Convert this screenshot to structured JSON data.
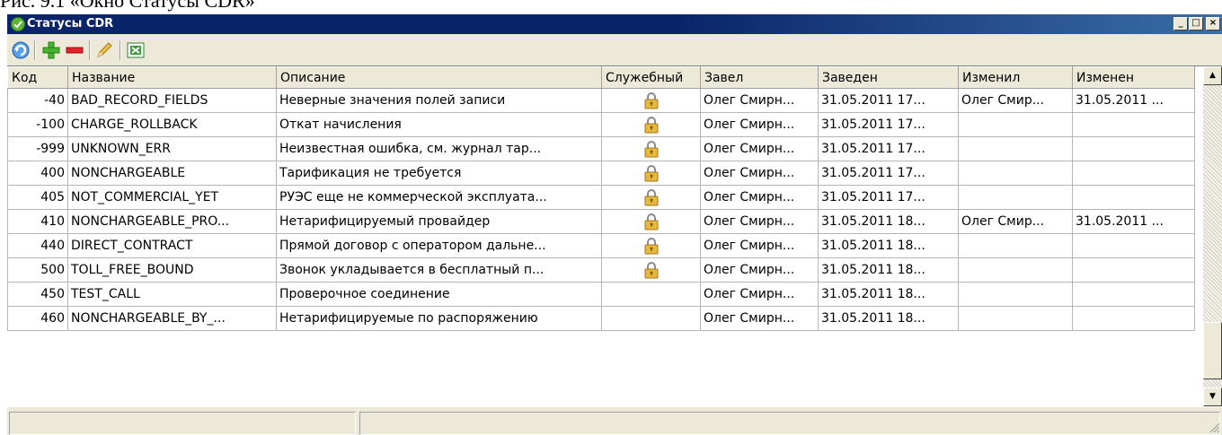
{
  "caption": "Рис. 9.1 «Окно Статусы CDR»",
  "window": {
    "title": "Статусы CDR",
    "app_icon": "green-check-shield-icon",
    "controls": {
      "minimize": "_",
      "maximize": "□",
      "close": "×"
    }
  },
  "toolbar": {
    "buttons": [
      {
        "name": "refresh",
        "icon": "refresh-icon"
      },
      {
        "name": "add",
        "icon": "plus-icon"
      },
      {
        "name": "delete",
        "icon": "minus-icon"
      },
      {
        "name": "edit",
        "icon": "pencil-icon"
      },
      {
        "name": "export",
        "icon": "excel-icon"
      }
    ]
  },
  "grid": {
    "columns": [
      "Код",
      "Название",
      "Описание",
      "Служебный",
      "Завел",
      "Заведен",
      "Изменил",
      "Изменен"
    ],
    "rows": [
      {
        "code": "-40",
        "name": "BAD_RECORD_FIELDS",
        "desc": "Неверные значения полей записи",
        "service": true,
        "created_by": "Олег Смирн...",
        "created_at": "31.05.2011 17...",
        "modified_by": "Олег Смир...",
        "modified_at": "31.05.2011 ..."
      },
      {
        "code": "-100",
        "name": "CHARGE_ROLLBACK",
        "desc": "Откат начисления",
        "service": true,
        "created_by": "Олег Смирн...",
        "created_at": "31.05.2011 17...",
        "modified_by": "",
        "modified_at": ""
      },
      {
        "code": "-999",
        "name": "UNKNOWN_ERR",
        "desc": "Неизвестная ошибка, см. журнал тар...",
        "service": true,
        "created_by": "Олег Смирн...",
        "created_at": "31.05.2011 17...",
        "modified_by": "",
        "modified_at": ""
      },
      {
        "code": "400",
        "name": "NONCHARGEABLE",
        "desc": "Тарификация не требуется",
        "service": true,
        "created_by": "Олег Смирн...",
        "created_at": "31.05.2011 17...",
        "modified_by": "",
        "modified_at": ""
      },
      {
        "code": "405",
        "name": "NOT_COMMERCIAL_YET",
        "desc": "РУЭС еще не коммерческой эксплуата...",
        "service": true,
        "created_by": "Олег Смирн...",
        "created_at": "31.05.2011 17...",
        "modified_by": "",
        "modified_at": ""
      },
      {
        "code": "410",
        "name": "NONCHARGEABLE_PRO...",
        "desc": "Нетарифицируемый провайдер",
        "service": true,
        "created_by": "Олег Смирн...",
        "created_at": "31.05.2011 18...",
        "modified_by": "Олег Смир...",
        "modified_at": "31.05.2011 ..."
      },
      {
        "code": "440",
        "name": "DIRECT_CONTRACT",
        "desc": "Прямой договор с оператором дальне...",
        "service": true,
        "created_by": "Олег Смирн...",
        "created_at": "31.05.2011 18...",
        "modified_by": "",
        "modified_at": ""
      },
      {
        "code": "500",
        "name": "TOLL_FREE_BOUND",
        "desc": "Звонок укладывается в бесплатный п...",
        "service": true,
        "created_by": "Олег Смирн...",
        "created_at": "31.05.2011 18...",
        "modified_by": "",
        "modified_at": ""
      },
      {
        "code": "450",
        "name": "TEST_CALL",
        "desc": "Проверочное соединение",
        "service": false,
        "created_by": "Олег Смирн...",
        "created_at": "31.05.2011 18...",
        "modified_by": "",
        "modified_at": ""
      },
      {
        "code": "460",
        "name": "NONCHARGEABLE_BY_...",
        "desc": "Нетарифицируемые по распоряжению",
        "service": false,
        "created_by": "Олег Смирн...",
        "created_at": "31.05.2011 18...",
        "modified_by": "",
        "modified_at": ""
      }
    ]
  },
  "scrollbar": {
    "up_icon": "scroll-up-arrow-icon",
    "down_icon": "scroll-down-arrow-icon"
  },
  "colors": {
    "titlebar": "#0a246a",
    "chrome": "#ece9d8",
    "lock": "#e8b83a"
  }
}
